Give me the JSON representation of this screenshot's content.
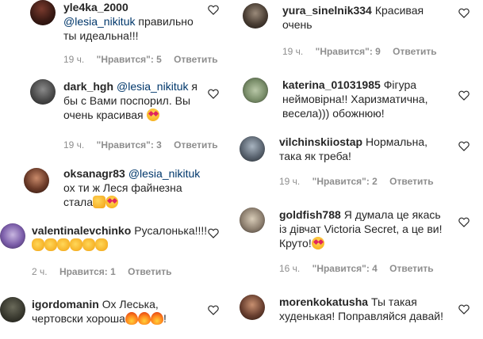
{
  "colors": {
    "text": "#262626",
    "muted": "#8e8e8e",
    "mention": "#00376b",
    "heart_outline": "#262626"
  },
  "comments_left": [
    {
      "username": "yle4ka_2000",
      "mention": "@lesia_nikituk",
      "text": " правильно ты идеальна!!!",
      "time": "19 ч.",
      "likes": "\"Нравится\": 5",
      "reply": "Ответить",
      "emoji": []
    },
    {
      "username": "dark_hgh",
      "mention": "@lesia_nikituk",
      "text": " я бы с Вами поспорил. Вы очень красивая ",
      "time": "19 ч.",
      "likes": "\"Нравится\": 3",
      "reply": "Ответить",
      "emoji": [
        "heart-eyes"
      ]
    },
    {
      "username": "oksanagr83",
      "mention": "@lesia_nikituk",
      "text": " ох ти ж Леся файнезна стала",
      "time": "",
      "likes": "",
      "reply": "",
      "emoji": [
        "thumb",
        "heart-eyes"
      ]
    },
    {
      "username": "valentinalevchinko",
      "mention": "",
      "text": "Русалонька!!!!",
      "time": "2 ч.",
      "likes": "Нравится: 1",
      "reply": "Ответить",
      "emoji": [
        "clap",
        "clap",
        "clap",
        "clap",
        "clap",
        "clap"
      ]
    },
    {
      "username": "igordomanin",
      "mention": "",
      "text": "Ох Леська, чертовски хороша",
      "time": "",
      "likes": "",
      "reply": "",
      "emoji": [
        "fire",
        "fire",
        "fire",
        "!"
      ]
    }
  ],
  "comments_right": [
    {
      "username": "yura_sinelnik334",
      "mention": "",
      "text": "Красивая очень",
      "time": "19 ч.",
      "likes": "\"Нравится\": 9",
      "reply": "Ответить",
      "emoji": []
    },
    {
      "username": "katerina_01031985",
      "mention": "",
      "text": "Фігура неймовірна!! Харизматична, весела))) обожнюю!",
      "time": "",
      "likes": "",
      "reply": "",
      "emoji": []
    },
    {
      "username": "vilchinskiiostap",
      "mention": "",
      "text": "Нормальна, така як треба!",
      "time": "19 ч.",
      "likes": "\"Нравится\": 2",
      "reply": "Ответить",
      "emoji": []
    },
    {
      "username": "goldfish788",
      "mention": "",
      "text": "Я думала це якась із дівчат Victoria Secret, а це ви! Круто!",
      "time": "16 ч.",
      "likes": "\"Нравится\": 4",
      "reply": "Ответить",
      "emoji": [
        "heart-eyes"
      ]
    },
    {
      "username": "morenkokatusha",
      "mention": "",
      "text": "Ты такая худенькая! Поправляйся давай!",
      "time": "",
      "likes": "",
      "reply": "",
      "emoji": []
    }
  ]
}
